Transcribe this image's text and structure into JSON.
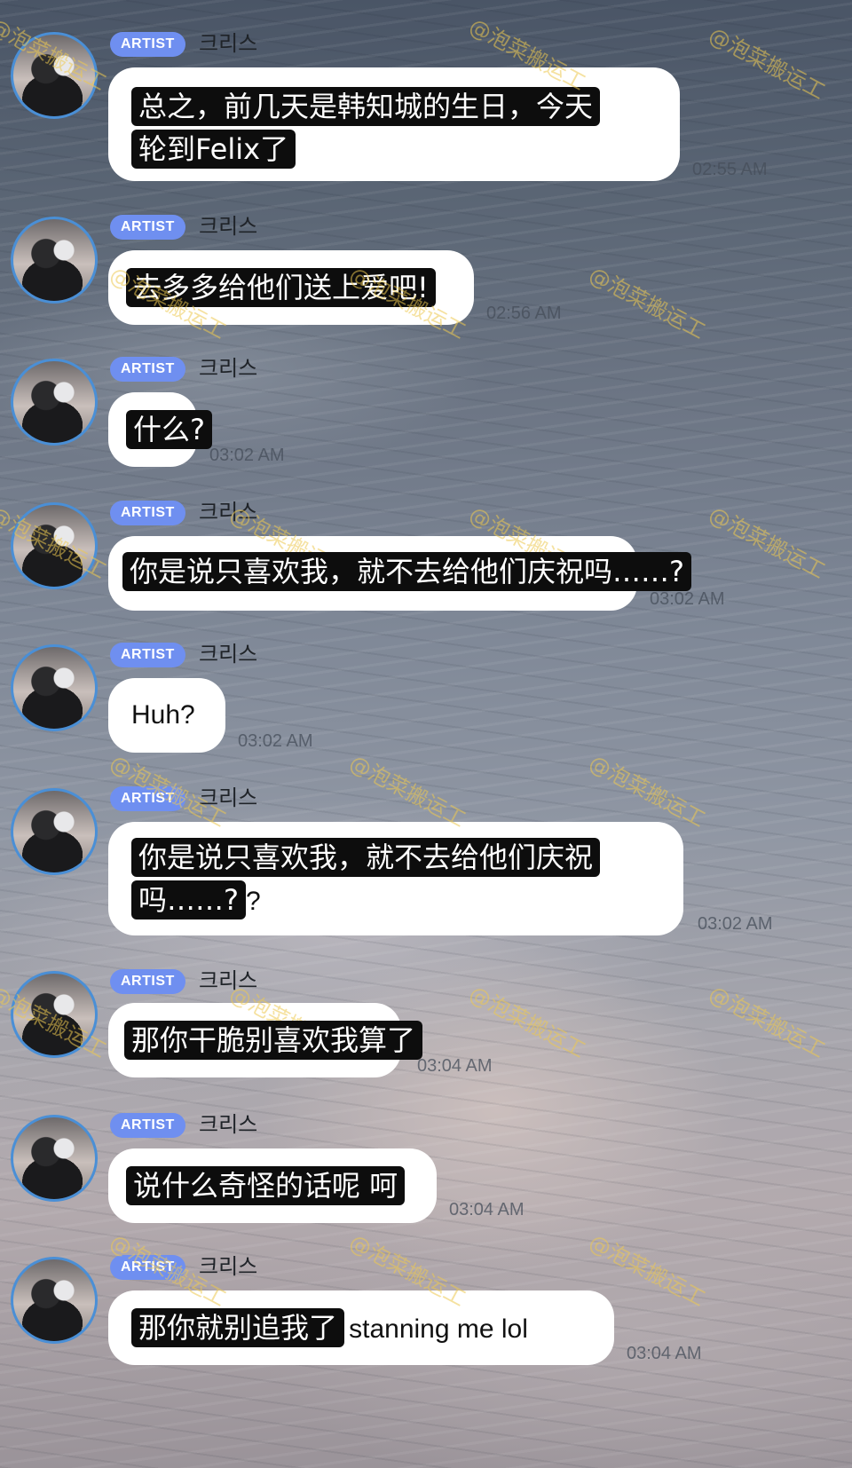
{
  "chat": {
    "messages": [
      {
        "badge": "ARTIST",
        "author": "크리스",
        "lines": [
          "总之，前几天是韩知城的生日，今天",
          "轮到Felix了"
        ],
        "time": "02:55 AM"
      },
      {
        "badge": "ARTIST",
        "author": "크리스",
        "lines": [
          "去多多给他们送上爱吧!"
        ],
        "time": "02:56 AM"
      },
      {
        "badge": "ARTIST",
        "author": "크리스",
        "lines": [
          "什么?"
        ],
        "time": "03:02 AM"
      },
      {
        "badge": "ARTIST",
        "author": "크리스",
        "lines": [
          "你是说只喜欢我，就不去给他们庆祝吗……?"
        ],
        "time": "03:02 AM"
      },
      {
        "badge": "ARTIST",
        "author": "크리스",
        "text": "Huh?",
        "time": "03:02 AM"
      },
      {
        "badge": "ARTIST",
        "author": "크리스",
        "lines": [
          "你是说只喜欢我，就不去给他们庆祝",
          "吗……?"
        ],
        "trail": "?",
        "time": "03:02 AM"
      },
      {
        "badge": "ARTIST",
        "author": "크리스",
        "lines": [
          "那你干脆别喜欢我算了"
        ],
        "time": "03:04 AM"
      },
      {
        "badge": "ARTIST",
        "author": "크리스",
        "lines": [
          "说什么奇怪的话呢 呵"
        ],
        "time": "03:04 AM"
      },
      {
        "badge": "ARTIST",
        "author": "크리스",
        "lines": [
          "那你就别追我了"
        ],
        "trail": "stanning me lol",
        "time": "03:04 AM"
      }
    ]
  },
  "watermark": "@泡菜搬运工"
}
